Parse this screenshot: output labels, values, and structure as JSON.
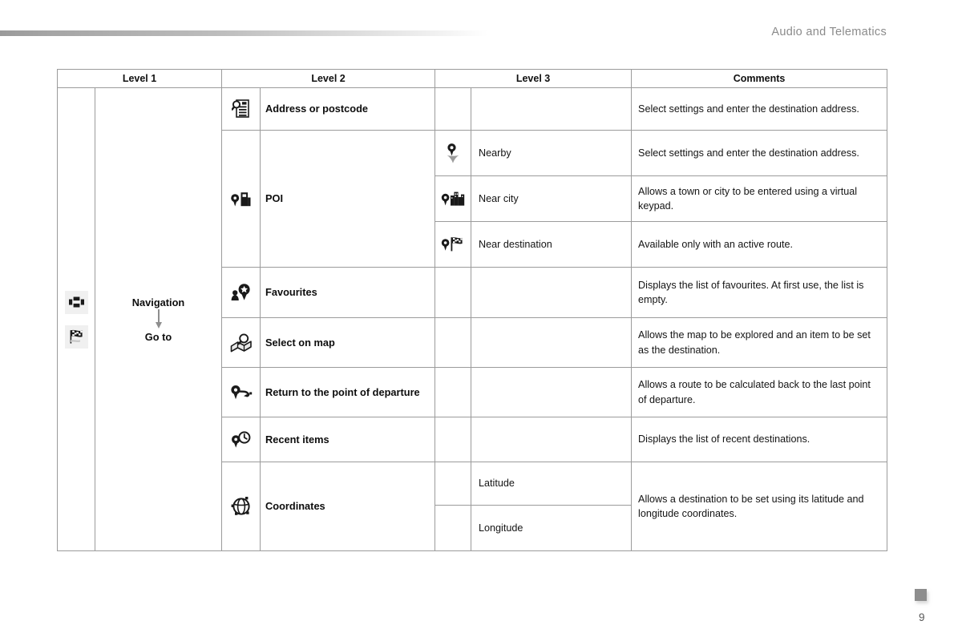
{
  "header": {
    "title": "Audio and Telematics"
  },
  "table": {
    "columns": [
      "Level 1",
      "Level 2",
      "Level 3",
      "Comments"
    ],
    "level1": {
      "top_label": "Navigation",
      "bottom_label": "Go to",
      "icons": [
        "navigation-menu-icon",
        "checkered-flag-icon"
      ]
    },
    "rows": [
      {
        "level2_icon": "address-document-search-icon",
        "level2": "Address or postcode",
        "level3_icon": "",
        "level3": "",
        "comment": "Select settings and enter the destination address."
      },
      {
        "level2_icon": "poi-pin-building-icon",
        "level2": "POI",
        "level3_icon": "pin-nearby-cursor-icon",
        "level3": "Nearby",
        "comment": "Select settings and enter the destination address."
      },
      {
        "level2_icon": "",
        "level2": "",
        "level3_icon": "pin-city-skyline-icon",
        "level3": "Near city",
        "comment": "Allows a town or city to be entered using a virtual keypad."
      },
      {
        "level2_icon": "",
        "level2": "",
        "level3_icon": "pin-checkered-flag-icon",
        "level3": "Near destination",
        "comment": "Available only with an active route."
      },
      {
        "level2_icon": "favourites-person-star-icon",
        "level2": "Favourites",
        "level3_icon": "",
        "level3": "",
        "comment": "Displays the list of favourites. At first use, the list is empty."
      },
      {
        "level2_icon": "map-magnifier-icon",
        "level2": "Select on map",
        "level3_icon": "",
        "level3": "",
        "comment": "Allows the map to be explored and an item to be set as the destination."
      },
      {
        "level2_icon": "return-departure-arrow-icon",
        "level2": "Return to the point of departure",
        "level3_icon": "",
        "level3": "",
        "comment": "Allows a route to be calculated back to the last point of departure."
      },
      {
        "level2_icon": "recent-items-clock-pin-icon",
        "level2": "Recent items",
        "level3_icon": "",
        "level3": "",
        "comment": "Displays the list of recent destinations."
      },
      {
        "level2_icon": "coordinates-globe-icon",
        "level2": "Coordinates",
        "level3_icon": "",
        "level3": "Latitude",
        "comment": "Allows a destination to be set using its latitude and longitude coordinates."
      },
      {
        "level2_icon": "",
        "level2": "",
        "level3_icon": "",
        "level3": "Longitude",
        "comment": ""
      }
    ]
  },
  "footer": {
    "page_number": "9"
  },
  "colors": {
    "header_bg": "#e3e3e3",
    "border": "#9b9b9b",
    "title_text": "#8b8b8b",
    "rule_start": "#9a9a9a"
  }
}
